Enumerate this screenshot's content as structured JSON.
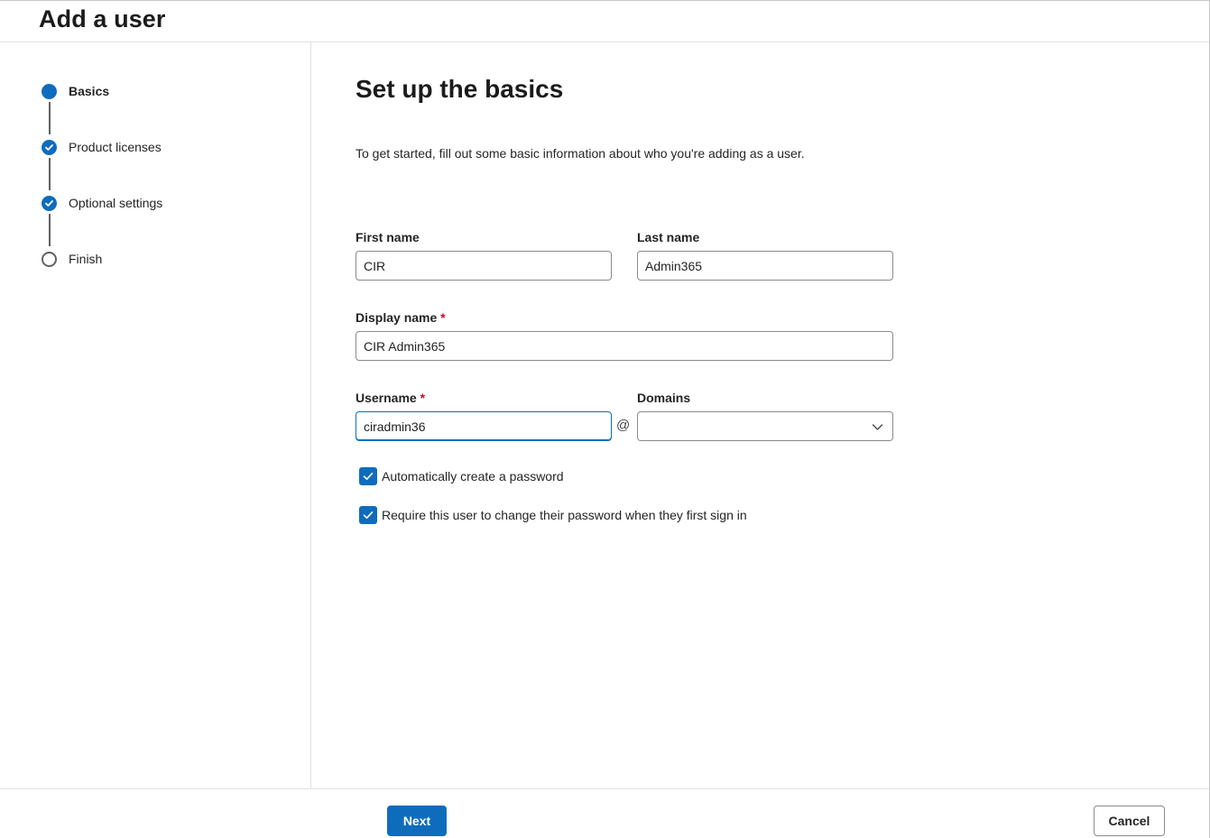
{
  "header": {
    "title": "Add a user"
  },
  "steps": [
    {
      "label": "Basics",
      "state": "current"
    },
    {
      "label": "Product licenses",
      "state": "done"
    },
    {
      "label": "Optional settings",
      "state": "done"
    },
    {
      "label": "Finish",
      "state": "todo"
    }
  ],
  "main": {
    "heading": "Set up the basics",
    "intro": "To get started, fill out some basic information about who you're adding as a user."
  },
  "form": {
    "first_name_label": "First name",
    "first_name_value": "CIR",
    "last_name_label": "Last name",
    "last_name_value": "Admin365",
    "display_name_label": "Display name",
    "display_name_value": "CIR Admin365",
    "username_label": "Username",
    "username_value": "ciradmin36",
    "required_marker": "*",
    "at_symbol": "@",
    "domains_label": "Domains",
    "domains_value": "",
    "auto_password_label": "Automatically create a password",
    "auto_password_checked": true,
    "require_change_label": "Require this user to change their password when they first sign in",
    "require_change_checked": true
  },
  "footer": {
    "next_label": "Next",
    "cancel_label": "Cancel"
  },
  "colors": {
    "accent": "#0f6cbd",
    "required": "#c50f1f",
    "border": "#8a8a8a"
  },
  "icons": {
    "check": "checkmark-icon",
    "chevron": "chevron-down-icon"
  }
}
